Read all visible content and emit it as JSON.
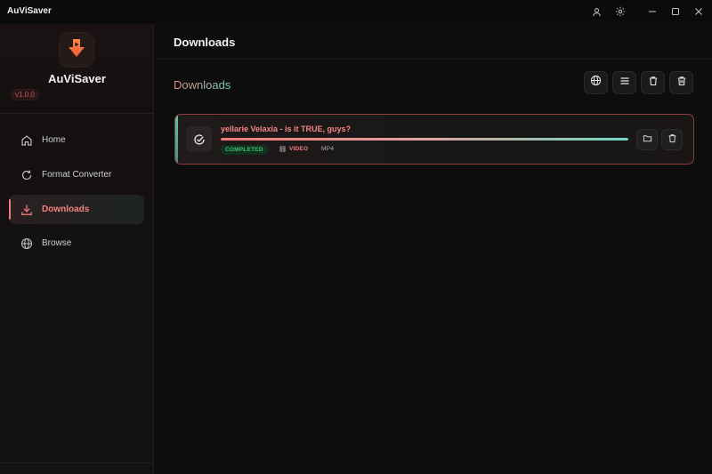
{
  "window": {
    "title": "AuViSaver",
    "controls": [
      "user-icon",
      "gear-icon",
      "minimize-icon",
      "maximize-icon",
      "close-icon"
    ]
  },
  "sidebar": {
    "brand": "AuViSaver",
    "version": "v1.0.0",
    "logo_icon": "download-logo-icon",
    "items": [
      {
        "label": "Home",
        "icon": "home-icon",
        "active": false
      },
      {
        "label": "Format Converter",
        "icon": "refresh-icon",
        "active": false
      },
      {
        "label": "Downloads",
        "icon": "download-icon",
        "active": true
      },
      {
        "label": "Browse",
        "icon": "globe-icon",
        "active": false
      }
    ]
  },
  "header": {
    "title": "Downloads"
  },
  "main": {
    "section_title": "Downloads",
    "toolbar": [
      "globe-icon",
      "menu-icon",
      "trash-icon",
      "trash-all-icon"
    ]
  },
  "downloads": [
    {
      "title": "yellarie Velaxia - is it TRUE, guys?",
      "status": "COMPLETED",
      "type": "VIDEO",
      "format": "MP4",
      "progress": 1.0
    }
  ],
  "colors": {
    "accent_red": "#f07a7a",
    "accent_teal": "#6fd6bf",
    "completed_green": "#3cc26b",
    "background": "#0d0d0d"
  }
}
